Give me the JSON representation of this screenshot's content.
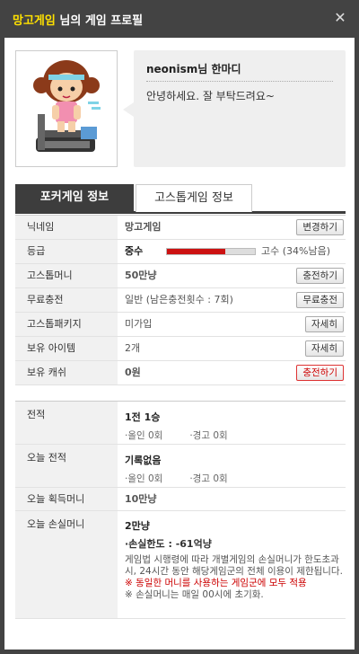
{
  "window": {
    "title_name": "망고게임",
    "title_rest": " 님의 게임 프로필"
  },
  "profile": {
    "bubble_title": "neonism님 한마디",
    "bubble_message": "안녕하세요. 잘 부탁드려요~"
  },
  "tabs": [
    "포커게임 정보",
    "고스톱게임 정보"
  ],
  "info": {
    "nickname_label": "닉네임",
    "nickname_value": "망고게임",
    "nickname_btn": "변경하기",
    "grade_label": "등급",
    "grade_value": "중수",
    "grade_progress": 0.66,
    "grade_next": "고수 (34%남음)",
    "gostop_money_label": "고스톱머니",
    "gostop_money_value": "50만냥",
    "gostop_money_btn": "충전하기",
    "free_charge_label": "무료충전",
    "free_charge_value": "일반 (남은충전횟수 : 7회)",
    "free_charge_btn": "무료충전",
    "package_label": "고스톱패키지",
    "package_value": "미가입",
    "package_btn": "자세히",
    "items_label": "보유 아이템",
    "items_value": "2개",
    "items_btn": "자세히",
    "cash_label": "보유 캐쉬",
    "cash_value": "0원",
    "cash_btn": "충전하기"
  },
  "stats": {
    "record_label": "전적",
    "record_value": "1전 1승",
    "record_out": "·올인 0회",
    "record_warn": "·경고 0회",
    "today_record_label": "오늘 전적",
    "today_record_value": "기록없음",
    "today_out": "·올인 0회",
    "today_warn": "·경고 0회",
    "today_gain_label": "오늘 획득머니",
    "today_gain_value": "10만냥",
    "today_loss_label": "오늘 손실머니",
    "today_loss_value": "2만냥",
    "loss_limit": "·손실한도 : -61억냥",
    "note1": "게임법 시행령에 따라 개별게임의 손실머니가 한도초과 시, 24시간 동안 해당게임군의 전체 이용이 제한됩니다.",
    "note2": "※ 동일한 머니를 사용하는 게임군에 모두 적용",
    "note3": "※ 손실머니는 매일 00시에 초기화."
  }
}
